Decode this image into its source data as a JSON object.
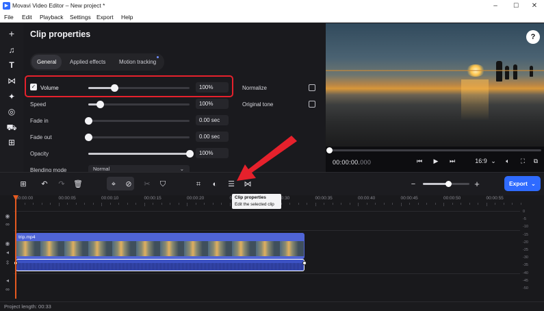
{
  "window": {
    "title": "Movavi Video Editor – New project *",
    "controls": {
      "minimize": "–",
      "maximize": "☐",
      "close": "✕"
    }
  },
  "menu": [
    "File",
    "Edit",
    "Playback",
    "Settings",
    "Export",
    "Help"
  ],
  "rail_icons": [
    "plus-icon",
    "music-icon",
    "text-icon",
    "transitions-icon",
    "effects-icon",
    "stickers-icon",
    "media-icon",
    "more-icon"
  ],
  "clip_properties": {
    "title": "Clip properties",
    "tabs": [
      "General",
      "Applied effects",
      "Motion tracking"
    ],
    "active_tab": "General",
    "volume": {
      "label": "Volume",
      "value": "100%",
      "checked": true,
      "level": 0.26
    },
    "speed": {
      "label": "Speed",
      "value": "100%",
      "level": 0.12
    },
    "fade_in": {
      "label": "Fade in",
      "value": "0.00 sec",
      "level": 0.0
    },
    "fade_out": {
      "label": "Fade out",
      "value": "0.00 sec",
      "level": 0.0
    },
    "opacity": {
      "label": "Opacity",
      "value": "100%",
      "level": 1.0
    },
    "blending": {
      "label": "Blending mode",
      "value": "Normal"
    },
    "normalize": {
      "label": "Normalize",
      "checked": false
    },
    "original_tone": {
      "label": "Original tone",
      "checked": false
    }
  },
  "preview": {
    "help": "?",
    "timecode_main": "00:00:00.",
    "timecode_frac": "000",
    "aspect": "16:9"
  },
  "toolbar": {
    "export_label": "Export",
    "tooltip_title": "Clip properties",
    "tooltip_desc": "Edit the selected clip",
    "zoom_level": 0.55
  },
  "timeline": {
    "ruler": [
      "00:00:00",
      "00:00:05",
      "00:00:10",
      "00:00:15",
      "00:00:20",
      "00:00:25",
      "00:00:30",
      "00:00:35",
      "00:00:40",
      "00:00:45",
      "00:00:50",
      "00:00:55"
    ],
    "clip_name": "trip.mp4",
    "levels": [
      "0",
      "-5",
      "-10",
      "-15",
      "-20",
      "-25",
      "-30",
      "-35",
      "-40",
      "-45",
      "-50"
    ]
  },
  "status": {
    "project_length": "Project length: 00:33"
  },
  "colors": {
    "accent": "#2f6bff",
    "highlight": "#e6212c",
    "playhead": "#e65a20",
    "clip": "#4f64d6"
  }
}
